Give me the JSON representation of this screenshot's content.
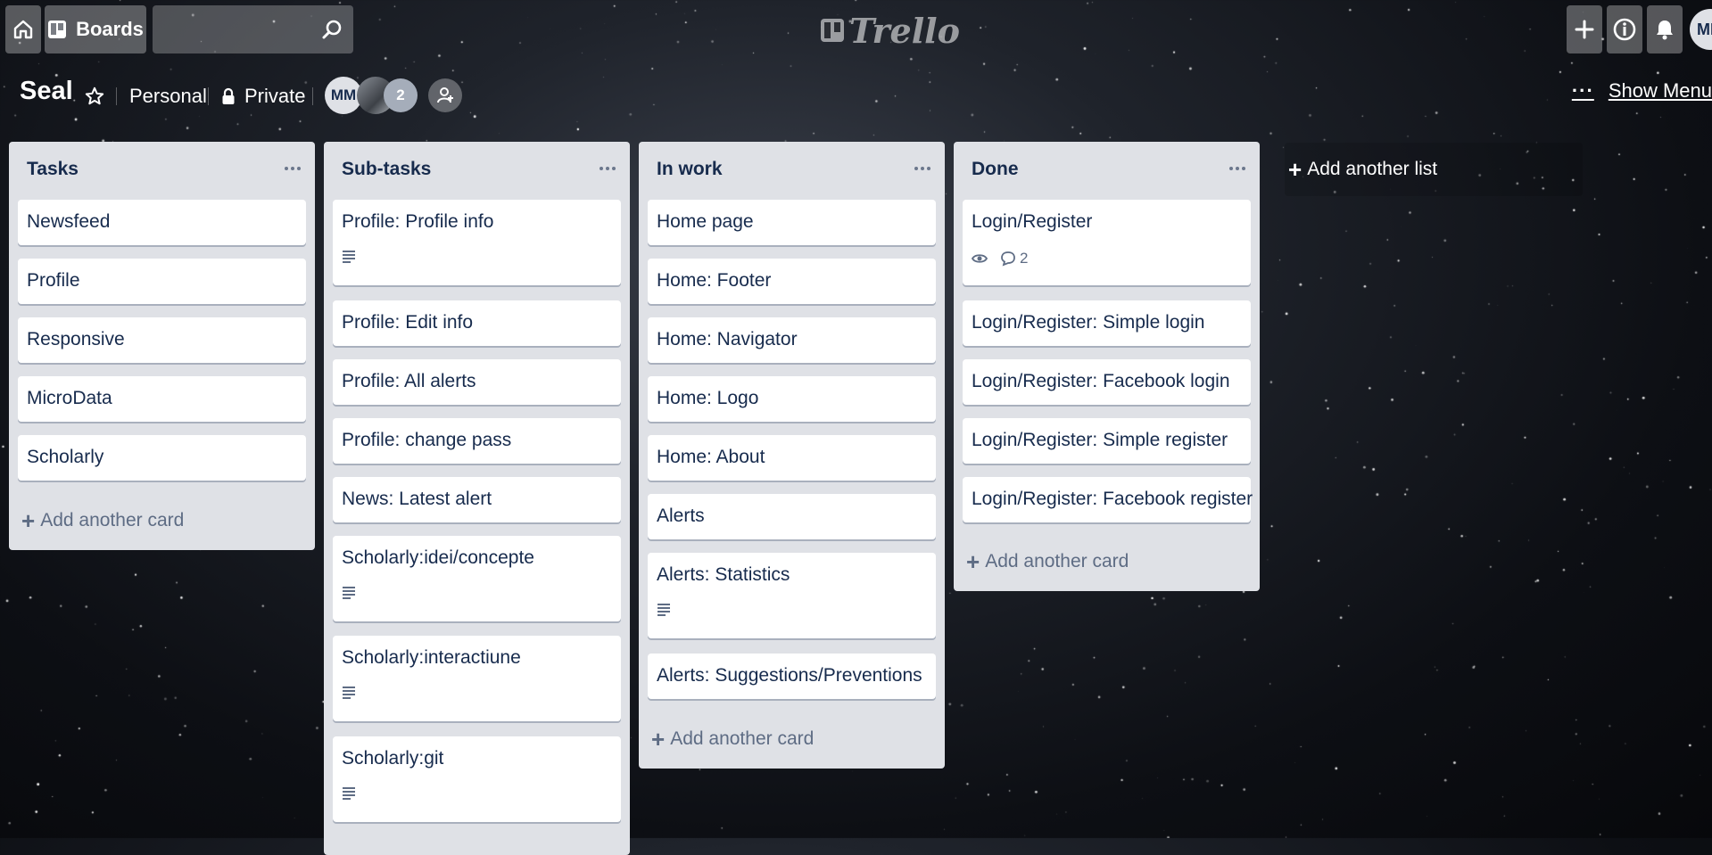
{
  "header": {
    "boards_label": "Boards",
    "search_placeholder": "",
    "logo_text": "Trello",
    "user_initials": "MM"
  },
  "board": {
    "title": "Seal",
    "team": "Personal",
    "visibility": "Private",
    "members": [
      "MM"
    ],
    "extra_members_count": "2",
    "show_menu_label": "Show Menu"
  },
  "lists": [
    {
      "title": "Tasks",
      "cards": [
        {
          "title": "Newsfeed"
        },
        {
          "title": "Profile"
        },
        {
          "title": "Responsive"
        },
        {
          "title": "MicroData"
        },
        {
          "title": "Scholarly"
        }
      ],
      "add_label": "Add another card"
    },
    {
      "title": "Sub-tasks",
      "cards": [
        {
          "title": "Profile: Profile info",
          "has_description": true
        },
        {
          "title": "Profile: Edit info"
        },
        {
          "title": "Profile: All alerts"
        },
        {
          "title": "Profile: change pass"
        },
        {
          "title": "News: Latest alert"
        },
        {
          "title": "Scholarly:idei/concepte",
          "has_description": true
        },
        {
          "title": "Scholarly:interactiune",
          "has_description": true
        },
        {
          "title": "Scholarly:git",
          "has_description": true
        }
      ]
    },
    {
      "title": "In work",
      "cards": [
        {
          "title": "Home page"
        },
        {
          "title": "Home: Footer"
        },
        {
          "title": "Home: Navigator"
        },
        {
          "title": "Home: Logo"
        },
        {
          "title": "Home: About"
        },
        {
          "title": "Alerts"
        },
        {
          "title": "Alerts: Statistics",
          "has_description": true
        },
        {
          "title": "Alerts: Suggestions/Preventions"
        }
      ],
      "add_label": "Add another card"
    },
    {
      "title": "Done",
      "cards": [
        {
          "title": "Login/Register",
          "watching": true,
          "comments": "2"
        },
        {
          "title": "Login/Register: Simple login"
        },
        {
          "title": "Login/Register: Facebook login"
        },
        {
          "title": "Login/Register: Simple register"
        },
        {
          "title": "Login/Register: Facebook register"
        }
      ],
      "add_label": "Add another card"
    }
  ],
  "add_list_label": "Add another list",
  "colors": {
    "list_bg": "#dfe1e6",
    "card_bg": "#ffffff",
    "text": "#172b4d",
    "muted": "#5e6c84"
  }
}
